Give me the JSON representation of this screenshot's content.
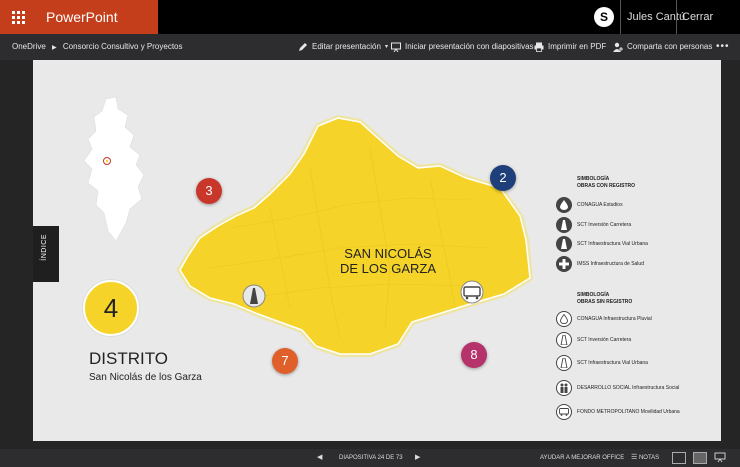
{
  "app": {
    "name": "PowerPoint Online"
  },
  "account": {
    "user": "Jules Cantú",
    "signout": "Cerrar sesión"
  },
  "breadcrumb": {
    "root": "OneDrive",
    "document": "Consorcio Consultivo y Proyectos"
  },
  "toolbar": {
    "edit": "Editar presentación",
    "present": "Iniciar presentación con diapositivas",
    "print": "Imprimir en PDF",
    "share": "Comparta con personas",
    "more": "•••"
  },
  "slide": {
    "indice_tab": "ÍNDICE",
    "district_number": "4",
    "district_title": "DISTRITO",
    "district_name": "San Nicolás de los Garza",
    "map_label_line1": "SAN NICOLÁS",
    "map_label_line2": "DE LOS GARZA",
    "markers": [
      {
        "label": "3",
        "color": "#c9362a"
      },
      {
        "label": "2",
        "color": "#1e3f7a"
      },
      {
        "label": "7",
        "color": "#e0602b"
      },
      {
        "label": "8",
        "color": "#b5336a"
      }
    ],
    "legend_registered": {
      "title_line1": "SIMBOLOGÍA",
      "title_line2": "OBRAS CON REGISTRO",
      "items": [
        {
          "icon": "water-drop-icon",
          "text": "CONAGUA Estudios"
        },
        {
          "icon": "road-icon",
          "text": "SCT Inversión Carretera"
        },
        {
          "icon": "road-icon",
          "text": "SCT Infraestructura Vial Urbana"
        },
        {
          "icon": "medical-cross-icon",
          "text": "IMSS Infraestructura de Salud"
        }
      ]
    },
    "legend_unregistered": {
      "title_line1": "SIMBOLOGÍA",
      "title_line2": "OBRAS SIN REGISTRO",
      "items": [
        {
          "icon": "water-drop-icon",
          "text": "CONAGUA Infraestructura Pluvial"
        },
        {
          "icon": "road-icon",
          "text": "SCT Inversión Carretera"
        },
        {
          "icon": "road-icon",
          "text": "SCT Infraestructura Vial Urbana"
        },
        {
          "icon": "people-icon",
          "text": "DESARROLLO SOCIAL Infraestructura Social"
        },
        {
          "icon": "bus-icon",
          "text": "FONDO METROPOLITANO Movilidad Urbana"
        }
      ]
    }
  },
  "status": {
    "slide_counter": "DIAPOSITIVA 24 DE 73",
    "help": "AYUDAR A MEJORAR OFFICE",
    "notes": "NOTAS"
  },
  "colors": {
    "brand": "#c43e1c",
    "map_fill": "#f5d328",
    "district": "#f5d328"
  }
}
